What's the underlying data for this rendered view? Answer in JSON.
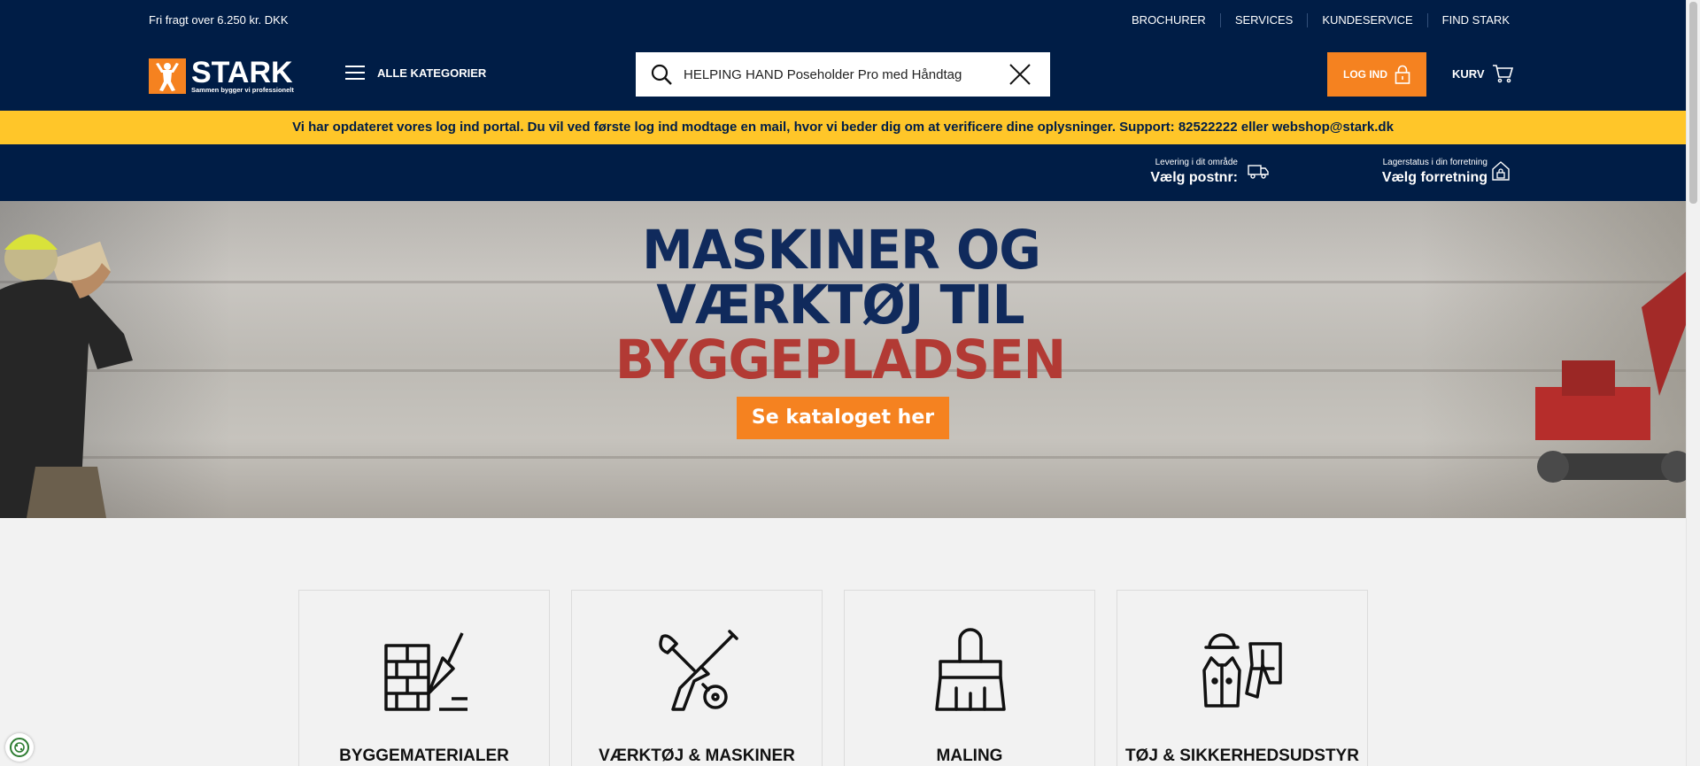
{
  "topbar": {
    "free_shipping": "Fri fragt over 6.250 kr. DKK",
    "links": [
      "BROCHURER",
      "SERVICES",
      "KUNDESERVICE",
      "FIND STARK"
    ]
  },
  "logo": {
    "name": "STARK",
    "tagline": "Sammen bygger vi professionelt"
  },
  "nav": {
    "all_categories": "ALLE KATEGORIER"
  },
  "search": {
    "value": "HELPING HAND Poseholder Pro med Håndtag"
  },
  "header": {
    "login": "LOG IND",
    "cart": "KURV"
  },
  "notice": "Vi har opdateret vores log ind portal. Du vil ved første log ind modtage en mail, hvor vi beder dig om at verificere dine oplysninger. Support: 82522222 eller webshop@stark.dk",
  "delivery": {
    "small": "Levering i dit område",
    "big": "Vælg postnr:"
  },
  "store": {
    "small": "Lagerstatus i din forretning",
    "big": "Vælg forretning"
  },
  "hero": {
    "line1": "MASKINER OG",
    "line2": "VÆRKTØJ TIL",
    "line3": "BYGGEPLADSEN",
    "cta": "Se kataloget her"
  },
  "categories": [
    {
      "title": "BYGGEMATERIALER",
      "icon": "brick-trowel-icon"
    },
    {
      "title": "VÆRKTØJ & MASKINER",
      "icon": "tools-icon"
    },
    {
      "title": "MALING",
      "icon": "paintbrush-icon"
    },
    {
      "title": "TØJ & SIKKERHEDSUDSTYR",
      "icon": "safety-gear-icon"
    }
  ],
  "colors": {
    "navy": "#001d46",
    "orange": "#f58220",
    "yellow": "#ffc629",
    "red": "#b23a34"
  }
}
